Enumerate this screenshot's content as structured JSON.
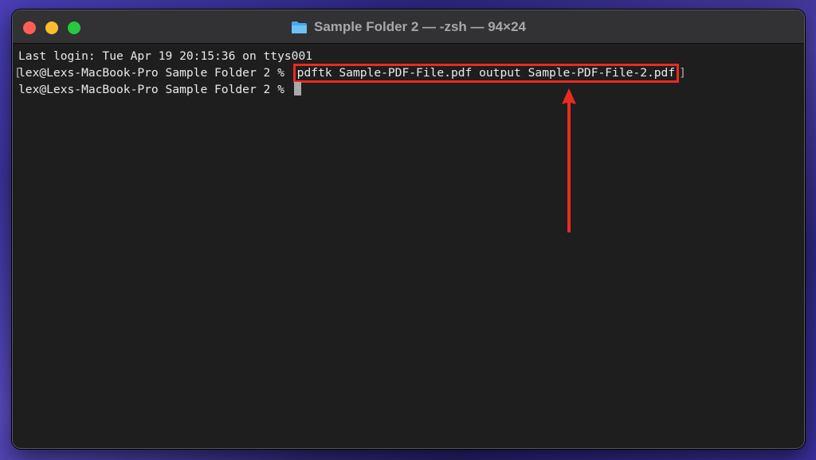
{
  "window": {
    "title": "Sample Folder 2 — -zsh — 94×24",
    "icon": "folder-icon",
    "colors": {
      "close": "#fe5f57",
      "minimize": "#febc2e",
      "zoom": "#28c840",
      "background": "#1e1e1e"
    }
  },
  "terminal": {
    "last_login": "Last login: Tue Apr 19 20:15:36 on ttys001",
    "prompt": "lex@Lexs-MacBook-Pro Sample Folder 2 %",
    "bracket_open": "[",
    "bracket_close": "]",
    "command": "pdftk Sample-PDF-File.pdf output Sample-PDF-File-2.pdf"
  },
  "annotation": {
    "color": "#ea2b1f",
    "icon": "arrow-up-icon"
  }
}
